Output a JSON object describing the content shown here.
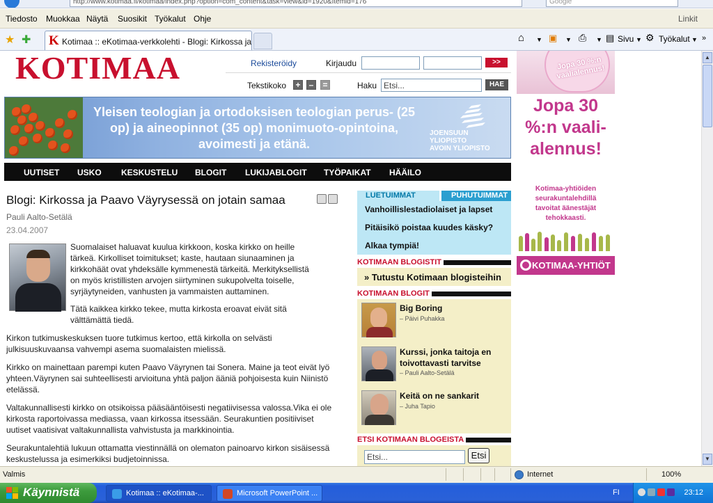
{
  "browser": {
    "address": "http://www.kotimaa.fi/kotimaa/index.php?option=com_content&task=view&id=1920&Itemid=176",
    "search_placeholder": "Google",
    "menu": [
      "Tiedosto",
      "Muokkaa",
      "Näytä",
      "Suosikit",
      "Työkalut",
      "Ohje"
    ],
    "links_label": "Linkit",
    "tab_title": "Kotimaa :: eKotimaa-verkkolehti - Blogi: Kirkossa ja Pa...",
    "tools": {
      "sivu": "Sivu",
      "tyokalut": "Työkalut"
    }
  },
  "site": {
    "logo": "KOTIMAA",
    "register": "Rekisteröidy",
    "login_label": "Kirjaudu",
    "login_go": ">>",
    "textsize_label": "Tekstikoko",
    "search_label": "Haku",
    "search_placeholder": "Etsi...",
    "search_button": "HAE"
  },
  "banner": {
    "text": "Yleisen teologian ja ortodoksisen teologian perus- (25 op) ja aineopinnot (35 op) monimuoto-opintoina, avoimesti ja etänä.",
    "uni_line1": "JOENSUUN",
    "uni_line2": "YLIOPISTO",
    "uni_line3": "AVOIN YLIOPISTO"
  },
  "nav": [
    "UUTISET",
    "USKO",
    "KESKUSTELU",
    "BLOGIT",
    "LUKIJABLOGIT",
    "TYÖPAIKAT",
    "HÄÄILO"
  ],
  "article": {
    "title": "Blogi: Kirkossa ja Paavo Väyrysessä on jotain samaa",
    "author": "Pauli Aalto-Setälä",
    "date": "23.04.2007",
    "p1": "Suomalaiset haluavat kuulua kirkkoon, koska kirkko on heille tärkeä. Kirkolliset toimitukset; kaste, hautaan siunaaminen ja kirkkohäät ovat yhdeksälle kymmenestä tärkeitä. Merkityksellistä on myös kristillisten arvojen siirtyminen sukupolvelta toiselle, syrjäytyneiden, vanhusten ja vammaisten auttaminen.",
    "p2": "Tätä kaikkea kirkko tekee, mutta kirkosta eroavat eivät sitä välttämättä tiedä.",
    "p3": "Kirkon tutkimuskeskuksen tuore tutkimus kertoo, että kirkolla on selvästi julkisuuskuvaansa vahvempi asema suomalaisten mielissä.",
    "p4": "Kirkko on mainettaan parempi kuten Paavo Väyrynen tai Sonera. Maine ja teot eivät lyö yhteen.Väyrynen sai suhteellisesti arvioituna yhtä paljon ääniä pohjoisesta kuin Niinistö etelässä.",
    "p5": "Valtakunnallisesti kirkko on otsikoissa pääsääntöisesti negatiivisessa valossa.Vika ei ole kirkosta raportoivassa mediassa, vaan kirkossa itsessään. Seurakuntien positiiviset uutiset vaatisivat valtakunnallista vahvistusta ja markkinointia.",
    "p6": "Seurakuntalehtiä lukuun ottamatta viestinnällä on olematon painoarvo kirkon sisäisessä keskustelussa ja esimerkiksi budjetoinnissa."
  },
  "sidebar": {
    "tab_read": "LUETUIMMAT",
    "tab_discussed": "PUHUTUIMMAT",
    "most_read": [
      "Vanhoillislestadiolaiset ja lapset",
      "Pitäisikö poistaa kuudes käsky?",
      "Alkaa tympiä!"
    ],
    "blogists_header": "KOTIMAAN BLOGISTIT",
    "blogists_link": "» Tutustu Kotimaan blogisteihin",
    "blogs_header": "KOTIMAAN BLOGIT",
    "blogs": [
      {
        "title": "Big Boring",
        "author": "– Päivi Puhakka"
      },
      {
        "title": "Kurssi, jonka taitoja en toivottavasti tarvitse",
        "author": "– Pauli Aalto-Setälä"
      },
      {
        "title": "Keitä on ne sankarit",
        "author": "– Juha Tapio"
      }
    ],
    "search_blogs_header": "ETSI KOTIMAAN BLOGEISTA",
    "search_blogs_placeholder": "Etsi...",
    "search_blogs_button": "Etsi"
  },
  "ad": {
    "top_text": "Jopa 30 %:n vaalialennus!",
    "big_text": "Jopa 30 %:n vaali- alennus!",
    "small_text": "Kotimaa-yhtiöiden seurakuntalehdillä tavoitat äänestäjät tehokkaasti.",
    "bar_text": "KOTIMAA-YHTIÖT"
  },
  "status": {
    "left": "Valmis",
    "zone": "Internet",
    "zoom": "100%"
  },
  "taskbar": {
    "start": "Käynnistä",
    "tasks": [
      "Kotimaa :: eKotimaa-...",
      "Microsoft PowerPoint ..."
    ],
    "lang": "FI",
    "clock": "23:12"
  }
}
